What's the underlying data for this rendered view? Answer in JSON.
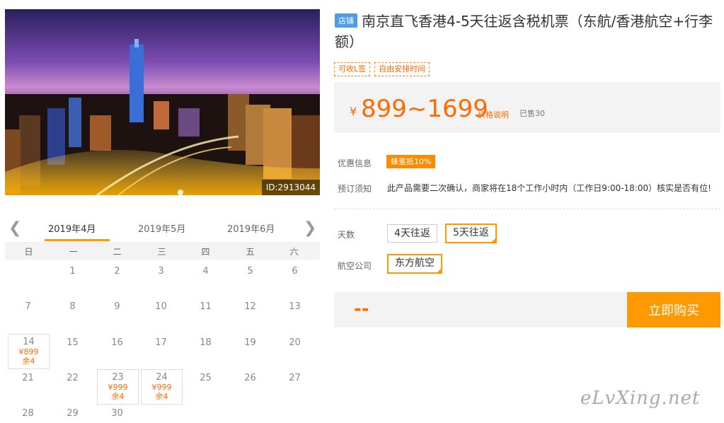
{
  "image": {
    "id_label": "ID:2913044"
  },
  "product": {
    "shop_badge": "店铺",
    "title": "南京直飞香港4-5天往返含税机票（东航/香港航空+行李额）",
    "tags": [
      "可收L签",
      "自由安排时间"
    ],
    "price_symbol": "¥",
    "price_range": "899~1699",
    "price_note": "价格说明",
    "sold": "已售30"
  },
  "info": {
    "promo_label": "优惠信息",
    "promo_badge": "蜂蜜抵10%",
    "notice_label": "预订须知",
    "notice_text": "此产品需要二次确认，商家将在18个工作小时内（工作日9:00-18:00）核实是否有位!"
  },
  "options": {
    "days_label": "天数",
    "days": [
      "4天往返",
      "5天往返"
    ],
    "days_selected": "5天往返",
    "airline_label": "航空公司",
    "airlines": [
      "东方航空"
    ],
    "airline_selected": "东方航空"
  },
  "buy": {
    "price_placeholder": "--",
    "button": "立即购买"
  },
  "calendar": {
    "months": [
      "2019年4月",
      "2019年5月",
      "2019年6月"
    ],
    "active_month": "2019年4月",
    "weekdays": [
      "日",
      "一",
      "二",
      "三",
      "四",
      "五",
      "六"
    ],
    "rows": [
      [
        "",
        "1",
        "2",
        "3",
        "4",
        "5",
        "6"
      ],
      [
        "7",
        "8",
        "9",
        "10",
        "11",
        "12",
        "13"
      ],
      [
        "14",
        "15",
        "16",
        "17",
        "18",
        "19",
        "20"
      ],
      [
        "21",
        "22",
        "23",
        "24",
        "25",
        "26",
        "27"
      ],
      [
        "28",
        "29",
        "30",
        "",
        "",
        "",
        ""
      ]
    ],
    "available": [
      {
        "day": "14",
        "price": "¥899",
        "stock": "余4"
      },
      {
        "day": "23",
        "price": "¥999",
        "stock": "余4"
      },
      {
        "day": "24",
        "price": "¥999",
        "stock": "余4"
      }
    ]
  },
  "watermark": "eLvXing.net",
  "colors": {
    "accent": "#ff9900",
    "price": "#ff6a00",
    "badge": "#4d9de6"
  }
}
